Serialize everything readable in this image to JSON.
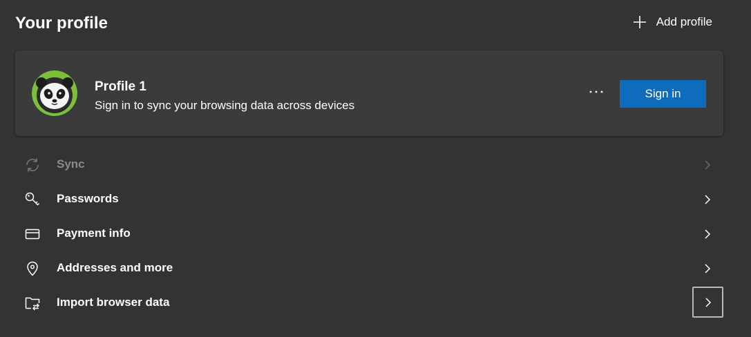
{
  "header": {
    "title": "Your profile",
    "add_profile_label": "Add profile",
    "add_icon": "plus-icon"
  },
  "profile_card": {
    "name": "Profile 1",
    "subtitle": "Sign in to sync your browsing data across devices",
    "more_label": "···",
    "sign_in_label": "Sign in",
    "avatar": "panda-avatar",
    "accent_color": "#0f6cbd",
    "avatar_ring_color": "#7cbf3a"
  },
  "menu": {
    "items": [
      {
        "label": "Sync",
        "icon": "sync-icon",
        "disabled": true
      },
      {
        "label": "Passwords",
        "icon": "key-icon",
        "disabled": false
      },
      {
        "label": "Payment info",
        "icon": "card-icon",
        "disabled": false
      },
      {
        "label": "Addresses and more",
        "icon": "location-pin-icon",
        "disabled": false
      },
      {
        "label": "Import browser data",
        "icon": "import-folder-icon",
        "disabled": false,
        "focused": true
      }
    ]
  }
}
